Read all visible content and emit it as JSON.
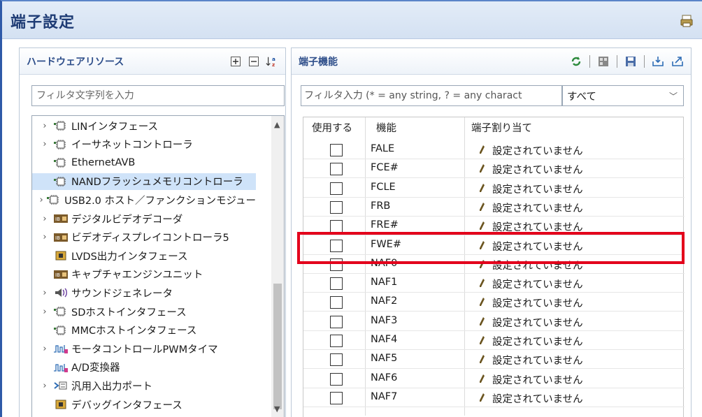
{
  "window": {
    "title": "端子設定"
  },
  "left_panel": {
    "title": "ハードウェアリソース",
    "filter_placeholder": "フィルタ文字列を入力",
    "tree": [
      {
        "label": "LINインタフェース",
        "expandable": true,
        "icon": "chip-icon"
      },
      {
        "label": "イーサネットコントローラ",
        "expandable": true,
        "icon": "chip-icon"
      },
      {
        "label": "EthernetAVB",
        "expandable": false,
        "icon": "chip-icon"
      },
      {
        "label": "NANDフラッシュメモリコントローラ",
        "expandable": false,
        "icon": "chip-icon",
        "selected": true
      },
      {
        "label": "USB2.0 ホスト／ファンクションモジュー",
        "expandable": true,
        "icon": "chip-icon"
      },
      {
        "label": "デジタルビデオデコーダ",
        "expandable": true,
        "icon": "video-icon"
      },
      {
        "label": "ビデオディスプレイコントローラ5",
        "expandable": true,
        "icon": "video-icon"
      },
      {
        "label": "LVDS出力インタフェース",
        "expandable": false,
        "icon": "lvds-icon"
      },
      {
        "label": "キャプチャエンジンユニット",
        "expandable": false,
        "icon": "video-icon"
      },
      {
        "label": "サウンドジェネレータ",
        "expandable": true,
        "icon": "sound-icon"
      },
      {
        "label": "SDホストインタフェース",
        "expandable": true,
        "icon": "chip-icon"
      },
      {
        "label": "MMCホストインタフェース",
        "expandable": false,
        "icon": "chip-icon"
      },
      {
        "label": "モータコントロールPWMタイマ",
        "expandable": true,
        "icon": "pwm-icon"
      },
      {
        "label": "A/D変換器",
        "expandable": false,
        "icon": "pwm-icon"
      },
      {
        "label": "汎用入出力ポート",
        "expandable": true,
        "icon": "gpio-icon"
      },
      {
        "label": "デバッグインタフェース",
        "expandable": false,
        "icon": "lvds-icon"
      }
    ]
  },
  "right_panel": {
    "title": "端子機能",
    "filter_placeholder": "フィルタ入力 (* = any string, ? = any charact",
    "scope_value": "すべて",
    "columns": {
      "use": "使用する",
      "function": "機能",
      "assign": "端子割り当て"
    },
    "rows": [
      {
        "function": "FALE",
        "assign": "設定されていません"
      },
      {
        "function": "FCE#",
        "assign": "設定されていません"
      },
      {
        "function": "FCLE",
        "assign": "設定されていません"
      },
      {
        "function": "FRB",
        "assign": "設定されていません"
      },
      {
        "function": "FRE#",
        "assign": "設定されていません"
      },
      {
        "function": "FWE#",
        "assign": "設定されていません"
      },
      {
        "function": "NAF0",
        "assign": "設定されていません"
      },
      {
        "function": "NAF1",
        "assign": "設定されていません"
      },
      {
        "function": "NAF2",
        "assign": "設定されていません"
      },
      {
        "function": "NAF3",
        "assign": "設定されていません"
      },
      {
        "function": "NAF4",
        "assign": "設定されていません"
      },
      {
        "function": "NAF5",
        "assign": "設定されていません"
      },
      {
        "function": "NAF6",
        "assign": "設定されていません"
      },
      {
        "function": "NAF7",
        "assign": "設定されていません"
      }
    ]
  },
  "colors": {
    "highlight": "#e3001b",
    "selected_row": "#cfe3f9",
    "title": "#1f3c75"
  }
}
